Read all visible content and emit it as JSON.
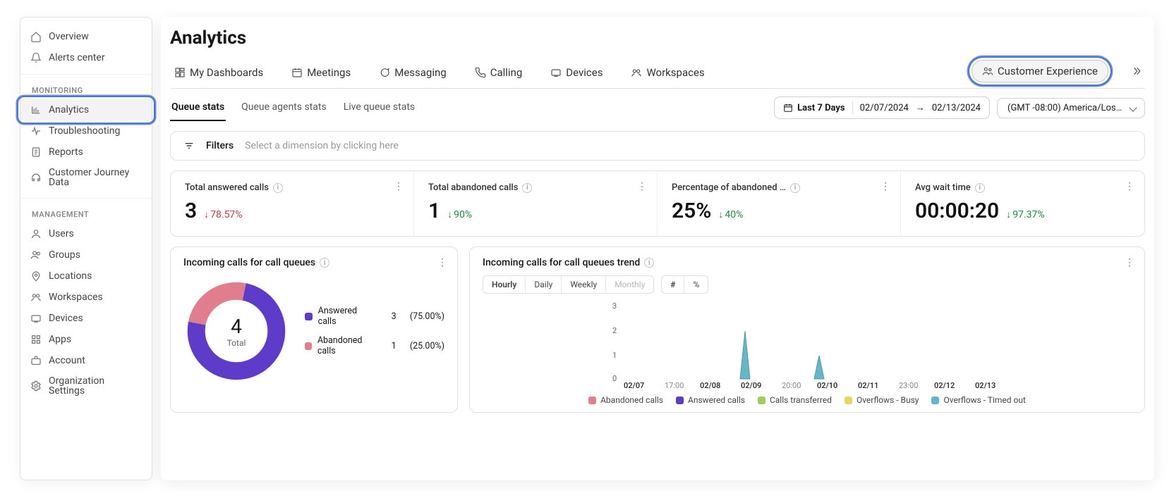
{
  "page": {
    "title": "Analytics"
  },
  "sidebar": {
    "top": [
      {
        "label": "Overview",
        "icon": "home-icon"
      },
      {
        "label": "Alerts center",
        "icon": "bell-icon"
      }
    ],
    "section1": {
      "label": "MONITORING"
    },
    "mon": [
      {
        "label": "Analytics",
        "icon": "chart-icon",
        "selected": true,
        "highlighted": true
      },
      {
        "label": "Troubleshooting",
        "icon": "pulse-icon"
      },
      {
        "label": "Reports",
        "icon": "doc-icon"
      },
      {
        "label": "Customer Journey Data",
        "icon": "headset-icon"
      }
    ],
    "section2": {
      "label": "MANAGEMENT"
    },
    "mgmt": [
      {
        "label": "Users",
        "icon": "user-icon"
      },
      {
        "label": "Groups",
        "icon": "users-icon"
      },
      {
        "label": "Locations",
        "icon": "pin-icon"
      },
      {
        "label": "Workspaces",
        "icon": "group-icon"
      },
      {
        "label": "Devices",
        "icon": "device-icon"
      },
      {
        "label": "Apps",
        "icon": "grid-icon"
      },
      {
        "label": "Account",
        "icon": "briefcase-icon"
      },
      {
        "label": "Organization Settings",
        "icon": "gear-icon"
      }
    ]
  },
  "tabs": [
    {
      "label": "My Dashboards",
      "icon": "dash-icon"
    },
    {
      "label": "Meetings",
      "icon": "calendar-icon"
    },
    {
      "label": "Messaging",
      "icon": "chat-icon"
    },
    {
      "label": "Calling",
      "icon": "phone-icon"
    },
    {
      "label": "Devices",
      "icon": "device-icon"
    },
    {
      "label": "Workspaces",
      "icon": "group-icon"
    },
    {
      "label": "Customer Experience",
      "icon": "people-icon",
      "pill": true,
      "highlighted": true
    }
  ],
  "subtabs": [
    {
      "label": "Queue stats",
      "active": true
    },
    {
      "label": "Queue agents stats"
    },
    {
      "label": "Live queue stats"
    }
  ],
  "range": {
    "preset": "Last 7 Days",
    "from": "02/07/2024",
    "to": "02/13/2024"
  },
  "timezone": "(GMT -08:00) America/Los …",
  "filters": {
    "title": "Filters",
    "placeholder": "Select a dimension by clicking here"
  },
  "kpis": [
    {
      "title": "Total answered calls",
      "value": "3",
      "delta": "78.57%",
      "dir": "down",
      "color": "red"
    },
    {
      "title": "Total abandoned calls",
      "value": "1",
      "delta": "90%",
      "dir": "down",
      "color": "green"
    },
    {
      "title": "Percentage of abandoned …",
      "value": "25%",
      "delta": "40%",
      "dir": "down",
      "color": "green"
    },
    {
      "title": "Avg wait time",
      "value": "00:00:20",
      "delta": "97.37%",
      "dir": "down",
      "color": "green"
    }
  ],
  "donut": {
    "title": "Incoming calls for call queues",
    "total_label": "Total",
    "total": "4",
    "legend": [
      {
        "name": "Answered calls",
        "count": "3",
        "pct": "(75.00%)",
        "color": "#5e3cc9"
      },
      {
        "name": "Abandoned calls",
        "count": "1",
        "pct": "(25.00%)",
        "color": "#e07e8e"
      }
    ]
  },
  "trend": {
    "title": "Incoming calls for call queues trend",
    "intervals": [
      "Hourly",
      "Daily",
      "Weekly",
      "Monthly"
    ],
    "interval_active": "Hourly",
    "modes": [
      "#",
      "%"
    ],
    "legend": [
      {
        "name": "Abandoned calls",
        "color": "#e07e8e"
      },
      {
        "name": "Answered calls",
        "color": "#5e3cc9"
      },
      {
        "name": "Calls transferred",
        "color": "#9ccf5a"
      },
      {
        "name": "Overflows - Busy",
        "color": "#e8d660"
      },
      {
        "name": "Overflows - Timed out",
        "color": "#64b6c8"
      }
    ]
  },
  "chart_data": [
    {
      "type": "pie",
      "title": "Incoming calls for call queues",
      "series": [
        {
          "name": "Answered calls",
          "value": 3,
          "pct": 75.0,
          "color": "#5e3cc9"
        },
        {
          "name": "Abandoned calls",
          "value": 1,
          "pct": 25.0,
          "color": "#e07e8e"
        }
      ],
      "total": 4
    },
    {
      "type": "area",
      "title": "Incoming calls for call queues trend",
      "x_ticks": [
        "02/07",
        "17:00",
        "02/08",
        "02/09",
        "20:00",
        "02/10",
        "02/11",
        "23:00",
        "02/12",
        "02/13"
      ],
      "ylim": [
        0,
        3
      ],
      "y_ticks": [
        0,
        1,
        2,
        3
      ],
      "series": [
        {
          "name": "Abandoned calls",
          "color": "#e07e8e",
          "values": [
            0,
            0,
            0,
            0,
            0,
            0,
            0,
            0,
            0,
            0
          ]
        },
        {
          "name": "Answered calls",
          "color": "#5e3cc9",
          "values": [
            0,
            0,
            0,
            0,
            0,
            0,
            0,
            0,
            0,
            0
          ]
        },
        {
          "name": "Calls transferred",
          "color": "#9ccf5a",
          "values": [
            0,
            0,
            0,
            0,
            0,
            0,
            0,
            0,
            0,
            0
          ]
        },
        {
          "name": "Overflows - Busy",
          "color": "#e8d660",
          "values": [
            0,
            0,
            0,
            0,
            0,
            0,
            0,
            0,
            0,
            0
          ]
        },
        {
          "name": "Overflows - Timed out",
          "color": "#64b6c8",
          "values": [
            0,
            0,
            0,
            2,
            0,
            1,
            0,
            0,
            0,
            0
          ]
        }
      ]
    }
  ]
}
